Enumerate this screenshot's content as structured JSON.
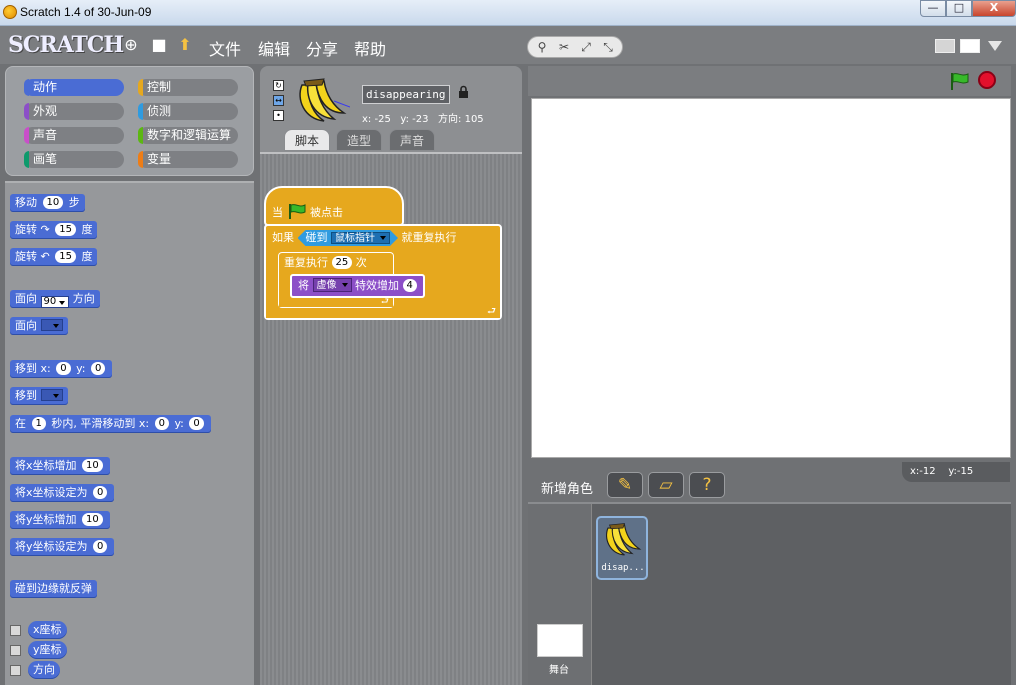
{
  "window": {
    "title": "Scratch 1.4 of 30-Jun-09",
    "min_glyph": "—",
    "max_glyph": "□",
    "close_glyph": "X"
  },
  "menubar": {
    "logo": "SCRATCH",
    "globe_glyph": "⊕",
    "save_glyph": "■",
    "share_glyph": "⬆",
    "items": [
      "文件",
      "编辑",
      "分享",
      "帮助"
    ],
    "tool_glyphs": [
      "⚲",
      "✂",
      "⤢",
      "⤡"
    ]
  },
  "categories": [
    {
      "label": "动作",
      "color": "#4a6cd4"
    },
    {
      "label": "控制",
      "color": "#e6a81e"
    },
    {
      "label": "外观",
      "color": "#8c4fc8"
    },
    {
      "label": "侦测",
      "color": "#2f9be0"
    },
    {
      "label": "声音",
      "color": "#c94fc9"
    },
    {
      "label": "数字和逻辑运算",
      "color": "#5cb712"
    },
    {
      "label": "画笔",
      "color": "#0e9a6c"
    },
    {
      "label": "变量",
      "color": "#ee7d16"
    }
  ],
  "selected_category": "动作",
  "blocks": {
    "move": {
      "pre": "移动",
      "value": "10",
      "post": "步"
    },
    "turn_right": {
      "pre": "旋转",
      "glyph": "↷",
      "value": "15",
      "post": "度"
    },
    "turn_left": {
      "pre": "旋转",
      "glyph": "↶",
      "value": "15",
      "post": "度"
    },
    "point_direction": {
      "pre": "面向",
      "value": "90",
      "post": "方向"
    },
    "point_towards": {
      "pre": "面向"
    },
    "go_to_xy": {
      "pre": "移到 x:",
      "x": "0",
      "mid": "y:",
      "y": "0"
    },
    "go_to": {
      "pre": "移到"
    },
    "glide": {
      "pre": "在",
      "secs": "1",
      "mid1": "秒内, 平滑移动到 x:",
      "x": "0",
      "mid2": "y:",
      "y": "0"
    },
    "change_x": {
      "pre": "将x坐标增加",
      "value": "10"
    },
    "set_x": {
      "pre": "将x坐标设定为",
      "value": "0"
    },
    "change_y": {
      "pre": "将y坐标增加",
      "value": "10"
    },
    "set_y": {
      "pre": "将y坐标设定为",
      "value": "0"
    },
    "bounce": {
      "label": "碰到边缘就反弹"
    },
    "reporters": [
      "x座标",
      "y座标",
      "方向"
    ]
  },
  "sprite": {
    "name": "disappearing",
    "lock_glyph": "🔒",
    "x_label": "x:",
    "x": "-25",
    "y_label": "y:",
    "y": "-23",
    "dir_label": "方向:",
    "direction": "105",
    "rotation_glyphs": [
      "↻",
      "↔",
      "•"
    ]
  },
  "tabs": [
    "脚本",
    "造型",
    "声音"
  ],
  "active_tab": "脚本",
  "script": {
    "hat": {
      "pre": "当",
      "post": "被点击"
    },
    "forever_if": {
      "pre": "如果",
      "sense_label": "碰到",
      "sense_value": "鼠标指针",
      "post": "就重复执行"
    },
    "repeat": {
      "pre": "重复执行",
      "value": "25",
      "post": "次"
    },
    "effect": {
      "pre": "将",
      "effect": "虚像",
      "mid": "特效增加",
      "value": "4"
    },
    "end_glyph": "⮐"
  },
  "stage": {
    "coord_readout": {
      "x_label": "x:",
      "x": "-12",
      "y_label": "y:",
      "y": "-15"
    },
    "new_sprite_label": "新增角色",
    "new_sprite_glyphs": [
      "✎",
      "▱",
      "?"
    ],
    "stage_label": "舞台"
  },
  "sprite_list": [
    {
      "name": "disap..."
    }
  ]
}
